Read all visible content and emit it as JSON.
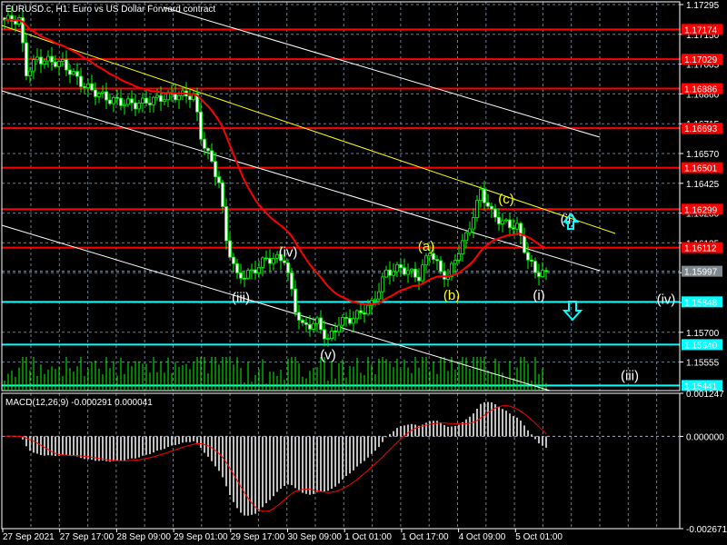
{
  "header": {
    "title": "EURUSD.c, H1:  Euro vs US Dollar Forward contract"
  },
  "macd_label": "MACD(12,26,9) -0.000291 0.000041",
  "colors": {
    "candle": "#00ff00",
    "ma": "#ff0000",
    "resistance": "#ff0000",
    "support": "#00ffff",
    "channel": "#ffffff",
    "trend": "#ffff00",
    "current": "#808890"
  },
  "chart_data": {
    "type": "candlestick",
    "symbol": "EURUSD.c",
    "timeframe": "H1",
    "price_axis": {
      "min": 1.15441,
      "max": 1.17295,
      "ticks": [
        "1.17295",
        "1.17150",
        "1.17005",
        "1.16860",
        "1.16715",
        "1.16570",
        "1.16425",
        "1.16280",
        "1.16135",
        "1.15990",
        "1.15845",
        "1.15700",
        "1.15555"
      ]
    },
    "time_labels": [
      "27 Sep 2021",
      "27 Sep 17:00",
      "28 Sep 09:00",
      "29 Sep 01:00",
      "29 Sep 17:00",
      "30 Sep 09:00",
      "1 Oct 01:00",
      "1 Oct 17:00",
      "4 Oct 09:00",
      "5 Oct 01:00"
    ],
    "close_waypoints": [
      [
        0,
        1.1722
      ],
      [
        4,
        1.1722
      ],
      [
        6,
        1.16963
      ],
      [
        9,
        1.1703
      ],
      [
        16,
        1.17008
      ],
      [
        22,
        1.16897
      ],
      [
        29,
        1.16831
      ],
      [
        36,
        1.16809
      ],
      [
        46,
        1.16853
      ],
      [
        52,
        1.16853
      ],
      [
        54,
        1.16654
      ],
      [
        59,
        1.16433
      ],
      [
        61,
        1.16146
      ],
      [
        64,
        1.15969
      ],
      [
        68,
        1.15991
      ],
      [
        72,
        1.16057
      ],
      [
        77,
        1.16057
      ],
      [
        80,
        1.15814
      ],
      [
        82,
        1.15726
      ],
      [
        86,
        1.15748
      ],
      [
        89,
        1.15659
      ],
      [
        92,
        1.15748
      ],
      [
        96,
        1.1577
      ],
      [
        101,
        1.15836
      ],
      [
        105,
        1.15991
      ],
      [
        109,
        1.16013
      ],
      [
        114,
        1.15969
      ],
      [
        117,
        1.16101
      ],
      [
        120,
        1.15991
      ],
      [
        122,
        1.15969
      ],
      [
        125,
        1.16101
      ],
      [
        127,
        1.16168
      ],
      [
        130,
        1.16322
      ],
      [
        131,
        1.16389
      ],
      [
        134,
        1.16278
      ],
      [
        137,
        1.16234
      ],
      [
        141,
        1.16212
      ],
      [
        144,
        1.16057
      ],
      [
        146,
        1.15991
      ],
      [
        149,
        1.15997
      ]
    ],
    "resistance_levels": [
      "1.17174",
      "1.17029",
      "1.16886",
      "1.16693",
      "1.16501",
      "1.16299",
      "1.16112"
    ],
    "support_levels": [
      "1.15848",
      "1.15640",
      "1.15441"
    ],
    "current_price": "1.15997",
    "wave_labels": [
      {
        "text": "(iii)",
        "bar": 65,
        "price": 1.1587,
        "color": "#ffffff"
      },
      {
        "text": "(iv)",
        "bar": 78,
        "price": 1.1609,
        "color": "#ffffff"
      },
      {
        "text": "(v)",
        "bar": 89,
        "price": 1.1559,
        "color": "#ffffff"
      },
      {
        "text": "(a)",
        "bar": 116,
        "price": 1.1612,
        "color": "#ffff00"
      },
      {
        "text": "(b)",
        "bar": 123,
        "price": 1.1588,
        "color": "#ffff00"
      },
      {
        "text": "(c)",
        "bar": 138,
        "price": 1.1635,
        "color": "#ffff00"
      },
      {
        "text": "(ii)",
        "bar": 155,
        "price": 1.1625,
        "color": "#ffffff"
      },
      {
        "text": "(i)",
        "bar": 147,
        "price": 1.1588,
        "color": "#ffffff"
      },
      {
        "text": "(iv)",
        "bar": 182,
        "price": 1.1586,
        "color": "#ffffff"
      },
      {
        "text": "(iii)",
        "bar": 172,
        "price": 1.1549,
        "color": "#ffffff"
      }
    ],
    "macd": {
      "fast": 12,
      "slow": 26,
      "signal": 9,
      "value": "-0.000291",
      "signal_value": "0.000041",
      "axis": [
        "0.001247",
        "0.000000",
        "-0.002671"
      ],
      "range": [
        -0.002671,
        0.001247
      ]
    }
  }
}
